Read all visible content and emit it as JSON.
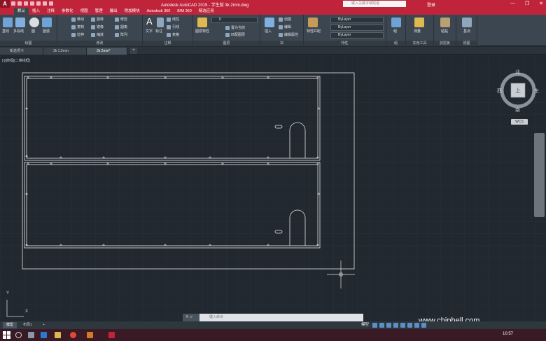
{
  "app": {
    "window_title": "Autodesk AutoCAD 2015 - 学生版    3k 2mm.dwg",
    "search_placeholder": "键入关键字或短语",
    "login_label": "登录",
    "window_buttons": [
      "—",
      "❐",
      "✕"
    ]
  },
  "ribbon_tabs": [
    {
      "label": "默认",
      "active": true
    },
    {
      "label": "插入",
      "active": false
    },
    {
      "label": "注释",
      "active": false
    },
    {
      "label": "参数化",
      "active": false
    },
    {
      "label": "视图",
      "active": false
    },
    {
      "label": "管理",
      "active": false
    },
    {
      "label": "输出",
      "active": false
    },
    {
      "label": "附加模块",
      "active": false
    },
    {
      "label": "Autodesk 360",
      "active": false
    },
    {
      "label": "BIM 360",
      "active": false
    },
    {
      "label": "精选应用",
      "active": false
    }
  ],
  "ribbon": {
    "draw": {
      "label": "绘图",
      "line": "直线",
      "polyline": "多段线",
      "circle": "圆",
      "arc": "圆弧"
    },
    "modify": {
      "label": "修改",
      "move": "移动",
      "rotate": "旋转",
      "trim": "修剪",
      "copy": "复制",
      "mirror": "镜像",
      "fillet": "圆角",
      "stretch": "拉伸",
      "scale": "缩放",
      "array": "阵列"
    },
    "annotation": {
      "label": "注释",
      "text": "文字",
      "dimension": "标注",
      "linear": "线性",
      "leader": "引线",
      "table": "表格"
    },
    "layers": {
      "label": "图层",
      "properties": "图层特性",
      "layer_value": "0",
      "make_current": "置为当前",
      "match": "匹配图层"
    },
    "block": {
      "label": "块",
      "insert": "插入",
      "create": "创建",
      "edit": "编辑",
      "edit_attr": "编辑属性"
    },
    "properties": {
      "label": "特性",
      "match": "特性匹配",
      "color": "ByLayer",
      "linetype": "ByLayer",
      "lineweight": "ByLayer"
    },
    "groups": {
      "label": "组",
      "group": "组"
    },
    "utilities": {
      "label": "实用工具",
      "measure": "测量"
    },
    "clipboard": {
      "label": "剪贴板",
      "paste": "粘贴"
    },
    "view": {
      "label": "视图",
      "base": "基点"
    }
  },
  "file_tabs": [
    {
      "label": "新选项卡",
      "active": false
    },
    {
      "label": "3k 1.5mm",
      "active": false
    },
    {
      "label": "3k 2mm*",
      "active": true
    }
  ],
  "viewport_label": "[-][俯视][二维线框]",
  "viewcube": {
    "north": "北",
    "south": "南",
    "east": "东",
    "west": "西",
    "face": "上",
    "wcs": "WCS"
  },
  "ucs": {
    "x": "X",
    "y": "Y"
  },
  "command_line": {
    "placeholder": "键入命令",
    "buttons": "✕ ⌕"
  },
  "status_tabs": [
    {
      "label": "模型",
      "active": true
    },
    {
      "label": "布局1",
      "active": false
    }
  ],
  "status_model": "模型",
  "taskbar": {
    "time": "10:57"
  },
  "watermark": "www.chiphell.com"
}
